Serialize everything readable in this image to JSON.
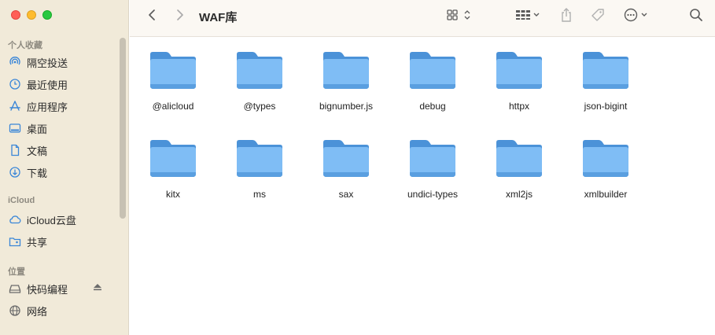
{
  "window": {
    "title": "WAF库"
  },
  "sidebar": {
    "favorites_title": "个人收藏",
    "favorites": [
      {
        "label": "隔空投送",
        "icon": "airdrop-icon"
      },
      {
        "label": "最近使用",
        "icon": "clock-icon"
      },
      {
        "label": "应用程序",
        "icon": "applications-icon"
      },
      {
        "label": "桌面",
        "icon": "desktop-icon"
      },
      {
        "label": "文稿",
        "icon": "document-icon"
      },
      {
        "label": "下载",
        "icon": "download-icon"
      }
    ],
    "icloud_title": "iCloud",
    "icloud": [
      {
        "label": "iCloud云盘",
        "icon": "cloud-icon"
      },
      {
        "label": "共享",
        "icon": "shared-folder-icon"
      }
    ],
    "locations_title": "位置",
    "locations": [
      {
        "label": "快码编程",
        "icon": "drive-icon"
      },
      {
        "label": "网络",
        "icon": "network-icon"
      }
    ]
  },
  "files": [
    {
      "name": "@alicloud"
    },
    {
      "name": "@types"
    },
    {
      "name": "bignumber.js"
    },
    {
      "name": "debug"
    },
    {
      "name": "httpx"
    },
    {
      "name": "json-bigint"
    },
    {
      "name": "kitx"
    },
    {
      "name": "ms"
    },
    {
      "name": "sax"
    },
    {
      "name": "undici-types"
    },
    {
      "name": "xml2js"
    },
    {
      "name": "xmlbuilder"
    }
  ]
}
